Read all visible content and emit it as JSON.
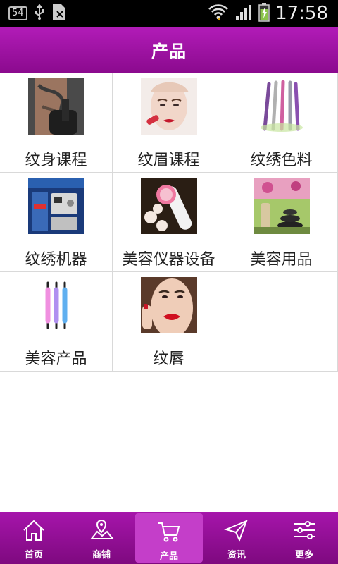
{
  "status_bar": {
    "badge": "54",
    "time": "17:58"
  },
  "header": {
    "title": "产品"
  },
  "products": [
    {
      "label": "纹身课程",
      "icon": "tattoo-photo"
    },
    {
      "label": "纹眉课程",
      "icon": "model-face-photo"
    },
    {
      "label": "纹绣色料",
      "icon": "pigment-pens-photo"
    },
    {
      "label": "纹绣机器",
      "icon": "machine-photo"
    },
    {
      "label": "美容仪器设备",
      "icon": "face-brush-photo"
    },
    {
      "label": "美容用品",
      "icon": "spa-stones-photo"
    },
    {
      "label": "美容产品",
      "icon": "needle-pens-photo"
    },
    {
      "label": "纹唇",
      "icon": "lips-photo"
    }
  ],
  "tabs": [
    {
      "label": "首页",
      "icon": "home-icon"
    },
    {
      "label": "商铺",
      "icon": "map-icon"
    },
    {
      "label": "产品",
      "icon": "cart-icon",
      "active": true
    },
    {
      "label": "资讯",
      "icon": "send-icon"
    },
    {
      "label": "更多",
      "icon": "sliders-icon"
    }
  ],
  "colors": {
    "brand": "#9a12a0",
    "tab_active": "#c43ec9"
  }
}
